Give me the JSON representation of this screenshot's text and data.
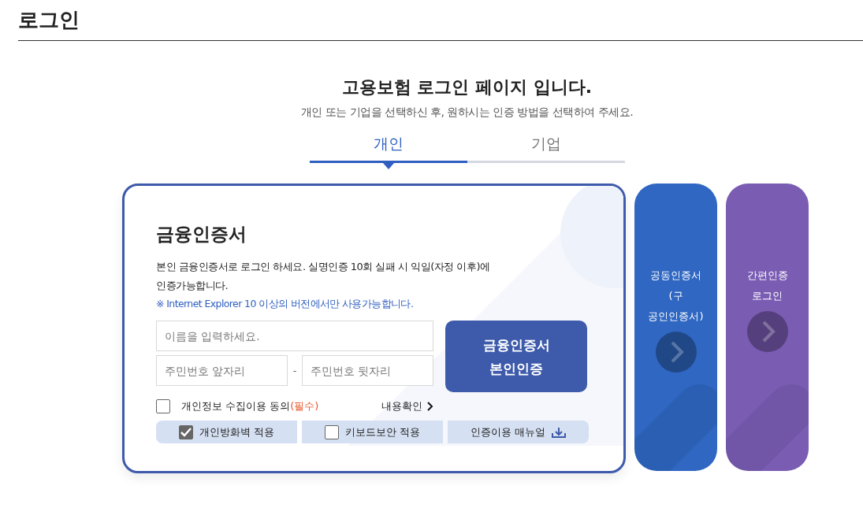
{
  "page_title": "로그인",
  "heading": "고용보험 로그인 페이지 입니다.",
  "subtitle": "개인 또는 기업을 선택하신 후, 원하시는 인증 방법을 선택하여 주세요.",
  "tabs": [
    {
      "label": "개인",
      "selected": true
    },
    {
      "label": "기업",
      "selected": false
    }
  ],
  "login_card": {
    "title": "금융인증서",
    "description": "본인 금융인증서로 로그인 하세요. 실명인증 10회 실패 시 익일(자정 이후)에 인증가능합니다.",
    "notice": "※ Internet Explorer 10 이상의 버전에서만 사용가능합니다.",
    "name_field": {
      "placeholder": "이름을 입력하세요."
    },
    "id_front_field": {
      "placeholder": "주민번호 앞자리"
    },
    "id_separator": "-",
    "id_back_field": {
      "placeholder": "주민번호 뒷자리"
    },
    "submit_button": [
      "금융인증서",
      "본인인증"
    ],
    "consent": {
      "label": "개인정보 수집이용 동의",
      "required_mark": "(필수)",
      "checked": false
    },
    "details_link": "내용확인",
    "options": [
      {
        "kind": "checkbox",
        "label": "개인방화벽 적용",
        "checked": true
      },
      {
        "kind": "checkbox",
        "label": "키보드보안 적용",
        "checked": false
      },
      {
        "kind": "download",
        "label": "인증이용 매뉴얼"
      }
    ]
  },
  "side_cards": [
    {
      "lines": [
        "공동인증서",
        "(구",
        "공인인증서)"
      ],
      "color": "#2f67c2"
    },
    {
      "lines": [
        "간편인증",
        "로그인"
      ],
      "color": "#7a5cb3"
    }
  ]
}
